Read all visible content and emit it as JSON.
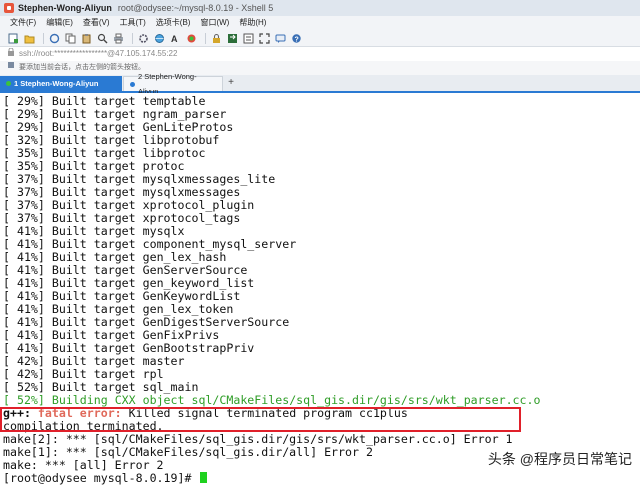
{
  "window": {
    "title_strong": "Stephen-Wong-Aliyun",
    "title_rest": "root@odysee:~/mysql-8.0.19 - Xshell 5"
  },
  "menu": [
    "文件(F)",
    "编辑(E)",
    "查看(V)",
    "工具(T)",
    "选项卡(B)",
    "窗口(W)",
    "帮助(H)"
  ],
  "toolbar_icons": [
    "new-session-icon",
    "open-folder-icon",
    "reconnect-icon",
    "copy-icon",
    "paste-icon",
    "find-icon",
    "print-icon",
    "properties-icon",
    "globe-icon",
    "font-icon",
    "color-icon",
    "lock-icon",
    "transfer-icon",
    "script-icon",
    "fullscreen-icon",
    "chat-icon",
    "help-icon"
  ],
  "address": {
    "text": "ssh://root:*****************@47.105.174.55:22"
  },
  "hint": {
    "text": "要添加当前会话，点击左侧的箭头按钮。"
  },
  "tabs": [
    {
      "label": "1 Stephen-Wong-Aliyun",
      "active": true,
      "dot_color": "#3cc23c"
    },
    {
      "label": "2 Stephen-Wong-Aliyun",
      "active": false,
      "dot_color": "#2a7ad3"
    }
  ],
  "tab_add_label": "+",
  "terminal": {
    "lines": [
      {
        "pct": "[ 29%]",
        "text": " Built target temptable",
        "style": "normal"
      },
      {
        "pct": "[ 29%]",
        "text": " Built target ngram_parser",
        "style": "normal"
      },
      {
        "pct": "[ 29%]",
        "text": " Built target GenLiteProtos",
        "style": "normal"
      },
      {
        "pct": "[ 32%]",
        "text": " Built target libprotobuf",
        "style": "normal"
      },
      {
        "pct": "[ 35%]",
        "text": " Built target libprotoc",
        "style": "normal"
      },
      {
        "pct": "[ 35%]",
        "text": " Built target protoc",
        "style": "normal"
      },
      {
        "pct": "[ 37%]",
        "text": " Built target mysqlxmessages_lite",
        "style": "normal"
      },
      {
        "pct": "[ 37%]",
        "text": " Built target mysqlxmessages",
        "style": "normal"
      },
      {
        "pct": "[ 37%]",
        "text": " Built target xprotocol_plugin",
        "style": "normal"
      },
      {
        "pct": "[ 37%]",
        "text": " Built target xprotocol_tags",
        "style": "normal"
      },
      {
        "pct": "[ 41%]",
        "text": " Built target mysqlx",
        "style": "normal"
      },
      {
        "pct": "[ 41%]",
        "text": " Built target component_mysql_server",
        "style": "normal"
      },
      {
        "pct": "[ 41%]",
        "text": " Built target gen_lex_hash",
        "style": "normal"
      },
      {
        "pct": "[ 41%]",
        "text": " Built target GenServerSource",
        "style": "normal"
      },
      {
        "pct": "[ 41%]",
        "text": " Built target gen_keyword_list",
        "style": "normal"
      },
      {
        "pct": "[ 41%]",
        "text": " Built target GenKeywordList",
        "style": "normal"
      },
      {
        "pct": "[ 41%]",
        "text": " Built target gen_lex_token",
        "style": "normal"
      },
      {
        "pct": "[ 41%]",
        "text": " Built target GenDigestServerSource",
        "style": "normal"
      },
      {
        "pct": "[ 41%]",
        "text": " Built target GenFixPrivs",
        "style": "normal"
      },
      {
        "pct": "[ 41%]",
        "text": " Built target GenBootstrapPriv",
        "style": "normal"
      },
      {
        "pct": "[ 42%]",
        "text": " Built target master",
        "style": "normal"
      },
      {
        "pct": "[ 42%]",
        "text": " Built target rpl",
        "style": "normal"
      },
      {
        "pct": "[ 52%]",
        "text": " Built target sql_main",
        "style": "normal"
      },
      {
        "pct": "[ 52%]",
        "text": " Building CXX object sql/CMakeFiles/sql_gis.dir/gis/srs/wkt_parser.cc.o",
        "style": "green"
      }
    ],
    "error_prefix": "g++: ",
    "error_keyword": "fatal error:",
    "error_message": " Killed signal terminated program cc1plus",
    "compilation_line": "compilation terminated.",
    "make_lines": [
      "make[2]: *** [sql/CMakeFiles/sql_gis.dir/gis/srs/wkt_parser.cc.o] Error 1",
      "make[1]: *** [sql/CMakeFiles/sql_gis.dir/all] Error 2",
      "make: *** [all] Error 2"
    ],
    "prompt": "[root@odysee mysql-8.0.19]# "
  },
  "watermark": {
    "text": "头条 @程序员日常笔记"
  },
  "colors": {
    "highlight_box": "#e0202a",
    "green_text": "#2f9d27",
    "cursor": "#1fd11f",
    "tab_active": "#2a7ad3"
  }
}
